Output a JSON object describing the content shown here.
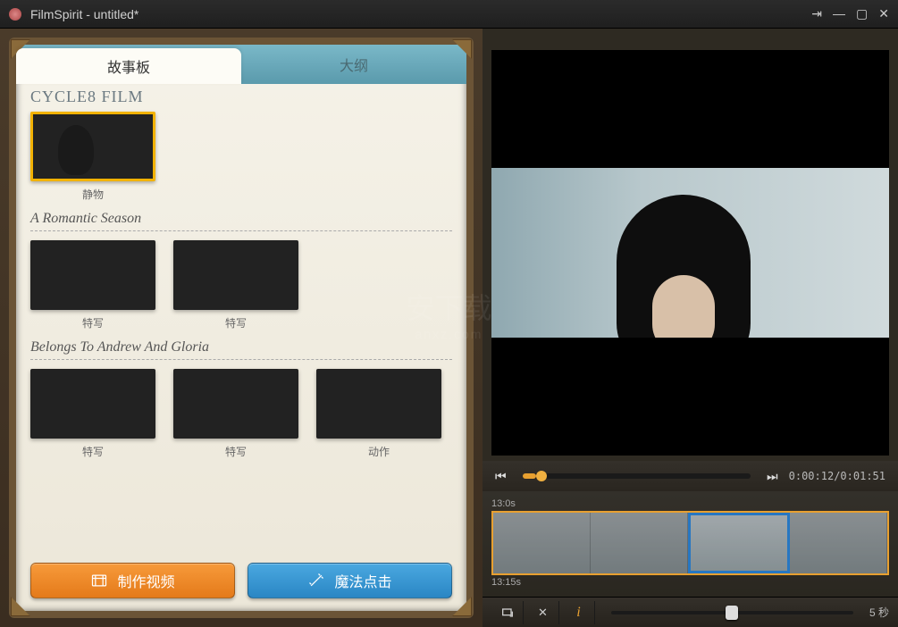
{
  "window": {
    "title": "FilmSpirit - untitled*"
  },
  "tabs": {
    "storyboard": "故事板",
    "outline": "大纲"
  },
  "brand": "CYCLE8 FILM",
  "sections": [
    {
      "title": "",
      "items": [
        {
          "caption": "静物",
          "selected": true,
          "style": "still-a"
        }
      ]
    },
    {
      "title": "A Romantic Season",
      "items": [
        {
          "caption": "特写",
          "style": "still-dark"
        },
        {
          "caption": "特写",
          "style": "still-dark2"
        }
      ]
    },
    {
      "title": "Belongs To Andrew And Gloria",
      "items": [
        {
          "caption": "特写",
          "style": "still-b"
        },
        {
          "caption": "特写",
          "style": "still-c"
        },
        {
          "caption": "动作",
          "style": "still-d"
        }
      ]
    }
  ],
  "buttons": {
    "make": "制作视频",
    "magic": "魔法点击"
  },
  "player": {
    "time": "0:00:12/0:01:51"
  },
  "timeline": {
    "top_label": "13:0s",
    "bottom_label": "13:15s"
  },
  "speed": {
    "label": "5 秒"
  },
  "watermark": {
    "main": "安下载",
    "sub": "anxz.com"
  }
}
